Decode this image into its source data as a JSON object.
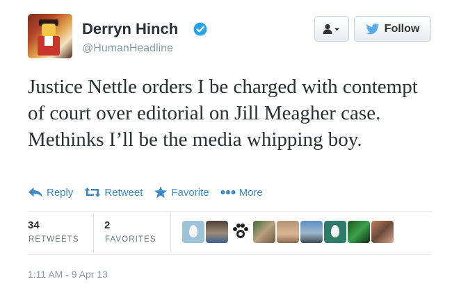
{
  "author": {
    "name": "Derryn Hinch",
    "handle": "@HumanHeadline",
    "verified": true,
    "avatar_icon": "profile-photo-avatar"
  },
  "header_buttons": {
    "user_menu_icon": "user-dropdown-icon",
    "follow_label": "Follow"
  },
  "tweet": {
    "text": "Justice Nettle orders I be charged with contempt of court over editorial on Jill Meagher case. Methinks I’ll be the media whipping boy."
  },
  "actions": [
    {
      "label": "Reply",
      "icon": "reply-icon"
    },
    {
      "label": "Retweet",
      "icon": "retweet-icon"
    },
    {
      "label": "Favorite",
      "icon": "star-icon"
    },
    {
      "label": "More",
      "icon": "more-dots-icon"
    }
  ],
  "stats": {
    "retweets": {
      "count": "34",
      "label": "RETWEETS"
    },
    "favorites": {
      "count": "2",
      "label": "FAVORITES"
    }
  },
  "timestamp": "1:11 AM - 9 Apr 13",
  "colors": {
    "link": "#3a89c9",
    "verified": "#2aa3ef",
    "twitter_bird": "#55acee",
    "muted": "#8899a6"
  }
}
